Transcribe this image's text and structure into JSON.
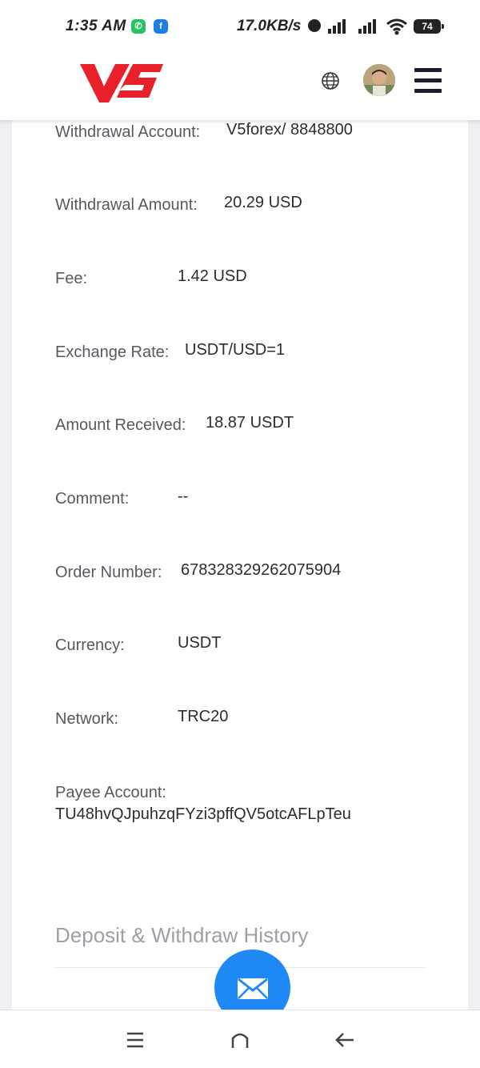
{
  "status_bar": {
    "time": "1:35 AM",
    "net_speed": "17.0KB/s",
    "battery": "74",
    "icons": [
      "whatsapp-icon",
      "facebook-icon",
      "alarm-icon",
      "signal-icon",
      "signal-icon",
      "wifi-icon",
      "battery-icon"
    ]
  },
  "header": {
    "logo_text": "V5",
    "brand_color": "#e8202a",
    "icons": [
      "globe-icon",
      "avatar",
      "menu-icon"
    ]
  },
  "details": [
    {
      "label": "Withdrawal Account:",
      "value": "V5forex/ 8848800"
    },
    {
      "label": "Withdrawal Amount:",
      "value": "20.29 USD"
    },
    {
      "label": "Fee:",
      "value": "1.42 USD"
    },
    {
      "label": "Exchange Rate:",
      "value": "USDT/USD=1"
    },
    {
      "label": "Amount Received:",
      "value": "18.87 USDT"
    },
    {
      "label": "Comment:",
      "value": "--"
    },
    {
      "label": "Order Number:",
      "value": "678328329262075904"
    },
    {
      "label": "Currency:",
      "value": "USDT"
    },
    {
      "label": "Network:",
      "value": "TRC20"
    }
  ],
  "payee": {
    "label": "Payee Account:",
    "value": "TU48hvQJpuhzqFYzi3pffQV5otcAFLpTeu"
  },
  "history_title": "Deposit & Withdraw History",
  "fab": {
    "icon": "mail-icon",
    "color": "#1e88f5"
  },
  "nav": [
    "recent-apps-icon",
    "home-icon",
    "back-icon"
  ]
}
